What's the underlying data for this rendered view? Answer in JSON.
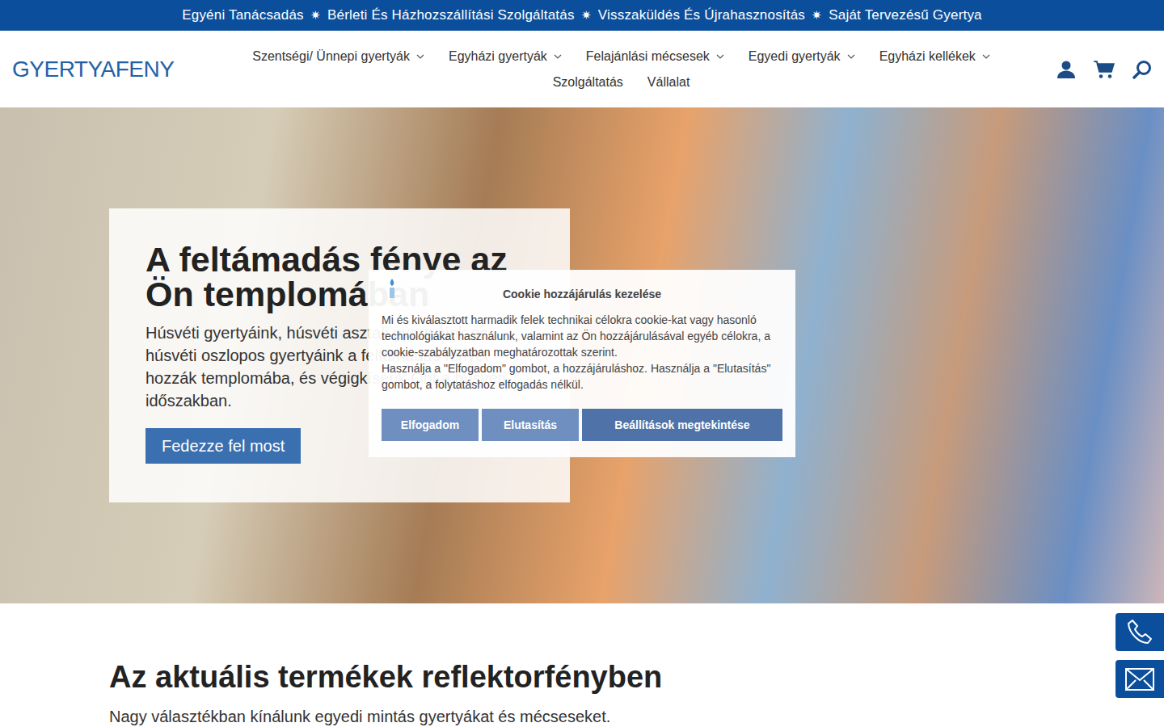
{
  "topbar": {
    "items": [
      "Egyéni Tanácsadás",
      "Bérleti És Házhozszállítási Szolgáltatás",
      "Visszaküldés És Újrahasznosítás",
      "Saját Tervezésű Gyertya"
    ],
    "separator": "✷"
  },
  "header": {
    "logo": "GYERTYAFENY",
    "nav": [
      {
        "label": "Szentségi/ Ünnepi gyertyák",
        "dropdown": true
      },
      {
        "label": "Egyházi gyertyák",
        "dropdown": true
      },
      {
        "label": "Felajánlási mécsesek",
        "dropdown": true
      },
      {
        "label": "Egyedi gyertyák",
        "dropdown": true
      },
      {
        "label": "Egyházi kellékek",
        "dropdown": true
      },
      {
        "label": "Szolgáltatás",
        "dropdown": false
      },
      {
        "label": "Vállalat",
        "dropdown": false
      }
    ]
  },
  "hero": {
    "title": "A feltámadás fénye az Ön templomában",
    "text": "Húsvéti gyertyáink, húsvéti asztali gyertyáink és húsvéti oszlopos gyertyáink a feltámadás fényét hozzák templomába, és végigkísérik Önt a húsvéti időszakban.",
    "button": "Fedezze fel most"
  },
  "cookie": {
    "title": "Cookie hozzájárulás kezelése",
    "paragraphs": [
      "Mi és kiválasztott harmadik felek technikai célokra cookie-kat vagy hasonló technológiákat használunk, valamint az Ön hozzájárulásával egyéb célokra, a cookie-szabályzatban meghatározottak szerint.",
      "Használja a \"Elfogadom\" gombot, a hozzájáruláshoz. Használja a \"Elutasítás\" gombot, a folytatáshoz elfogadás nélkül."
    ],
    "buttons": [
      "Elfogadom",
      "Elutasítás",
      "Beállítások megtekintése"
    ]
  },
  "section": {
    "title": "Az aktuális termékek reflektorfényben",
    "subtitle": "Nagy választékban kínálunk egyedi mintás gyertyákat és mécseseket."
  }
}
